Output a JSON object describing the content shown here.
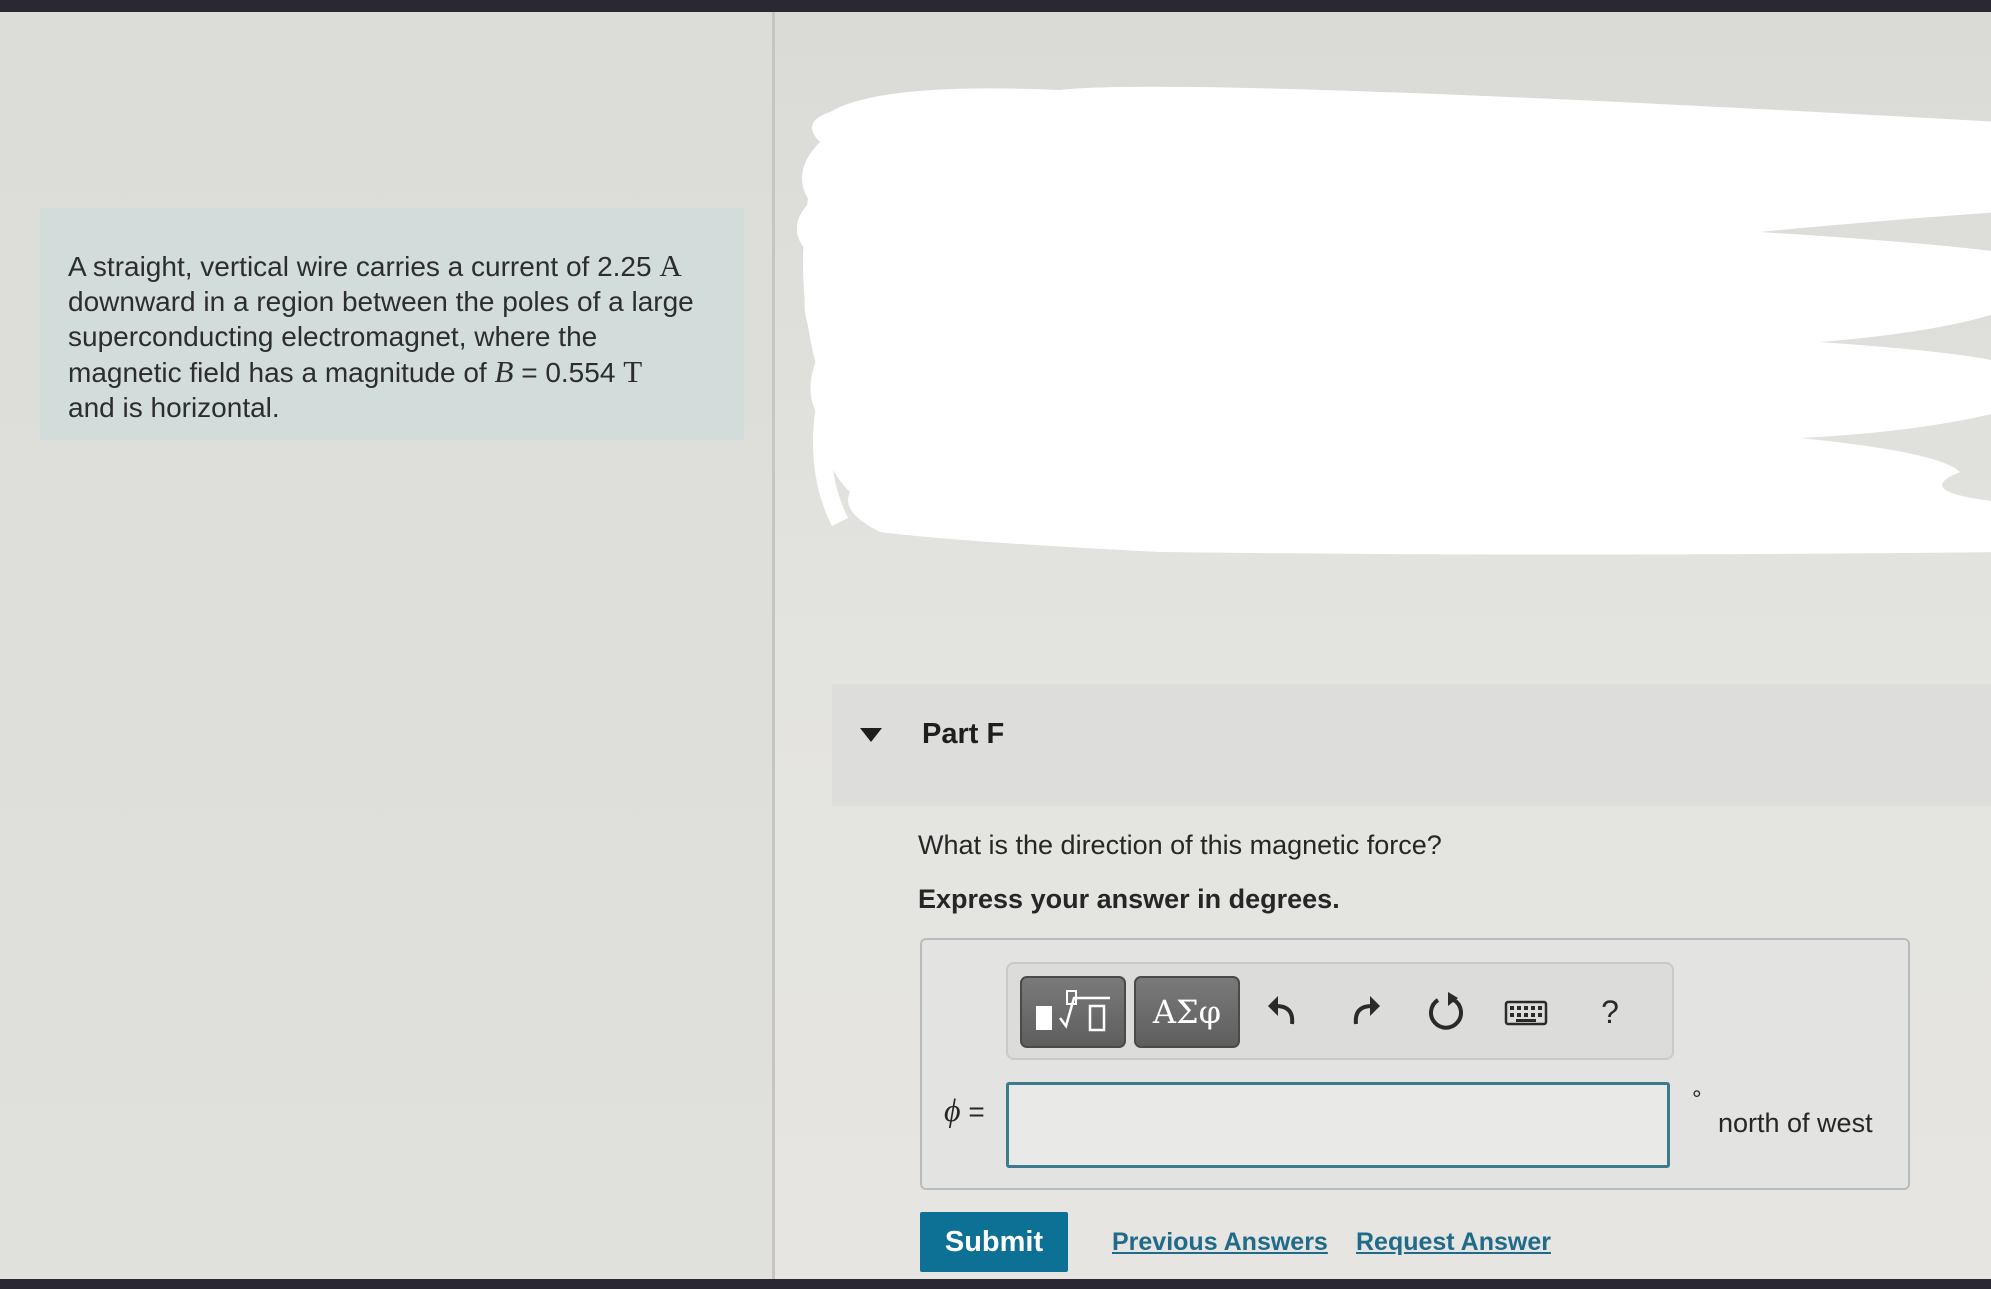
{
  "problem": {
    "line1_text": "A straight, vertical wire carries a current of 2.25",
    "line1_unit": "A",
    "line2": "downward in a region between the poles of a large",
    "line3": "superconducting electromagnet, where the",
    "line4_text": "magnetic field has a magnitude of",
    "line4_var": "B",
    "line4_eq": "= 0.554",
    "line4_unit": "T",
    "line5": "and is horizontal."
  },
  "part": {
    "title": "Part F",
    "question": "What is the direction of this magnetic force?",
    "instruction": "Express your answer in degrees."
  },
  "toolbar": {
    "greek_label": "ΑΣφ",
    "help_label": "?",
    "icons": [
      "templates-icon",
      "greek-symbols-icon",
      "undo-icon",
      "redo-icon",
      "reset-icon",
      "keyboard-icon",
      "help-icon"
    ]
  },
  "answer": {
    "symbol": "ϕ",
    "equals": "=",
    "value": "",
    "degree": "°",
    "unit": "north of west"
  },
  "actions": {
    "submit": "Submit",
    "previous_answers": "Previous Answers",
    "request_answer": "Request Answer"
  },
  "colors": {
    "submit_bg": "#0d7095",
    "link": "#206a8a",
    "input_border": "#3d7b8c"
  }
}
